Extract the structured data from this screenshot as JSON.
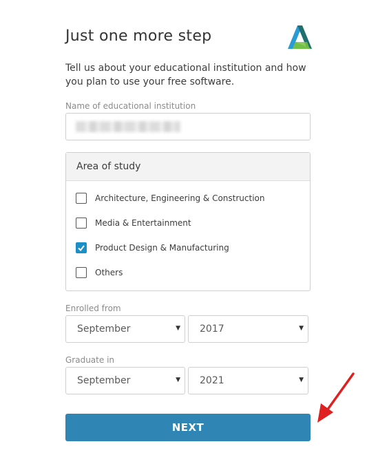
{
  "header": {
    "title": "Just one more step",
    "subtitle": "Tell us about your educational institution and how you plan to use your free software.",
    "logo_icon": "autodesk-logo-icon"
  },
  "institution": {
    "label": "Name of educational institution",
    "value_blurred": true
  },
  "area_of_study": {
    "heading": "Area of study",
    "options": [
      {
        "label": "Architecture, Engineering & Construction",
        "checked": false
      },
      {
        "label": "Media & Entertainment",
        "checked": false
      },
      {
        "label": "Product Design & Manufacturing",
        "checked": true
      },
      {
        "label": "Others",
        "checked": false
      }
    ]
  },
  "enrolled": {
    "label": "Enrolled from",
    "month": "September",
    "year": "2017"
  },
  "graduate": {
    "label": "Graduate in",
    "month": "September",
    "year": "2021"
  },
  "next_label": "NEXT",
  "colors": {
    "accent": "#1b8fc6",
    "button": "#2f86b5",
    "annotation_arrow": "#e02020"
  }
}
